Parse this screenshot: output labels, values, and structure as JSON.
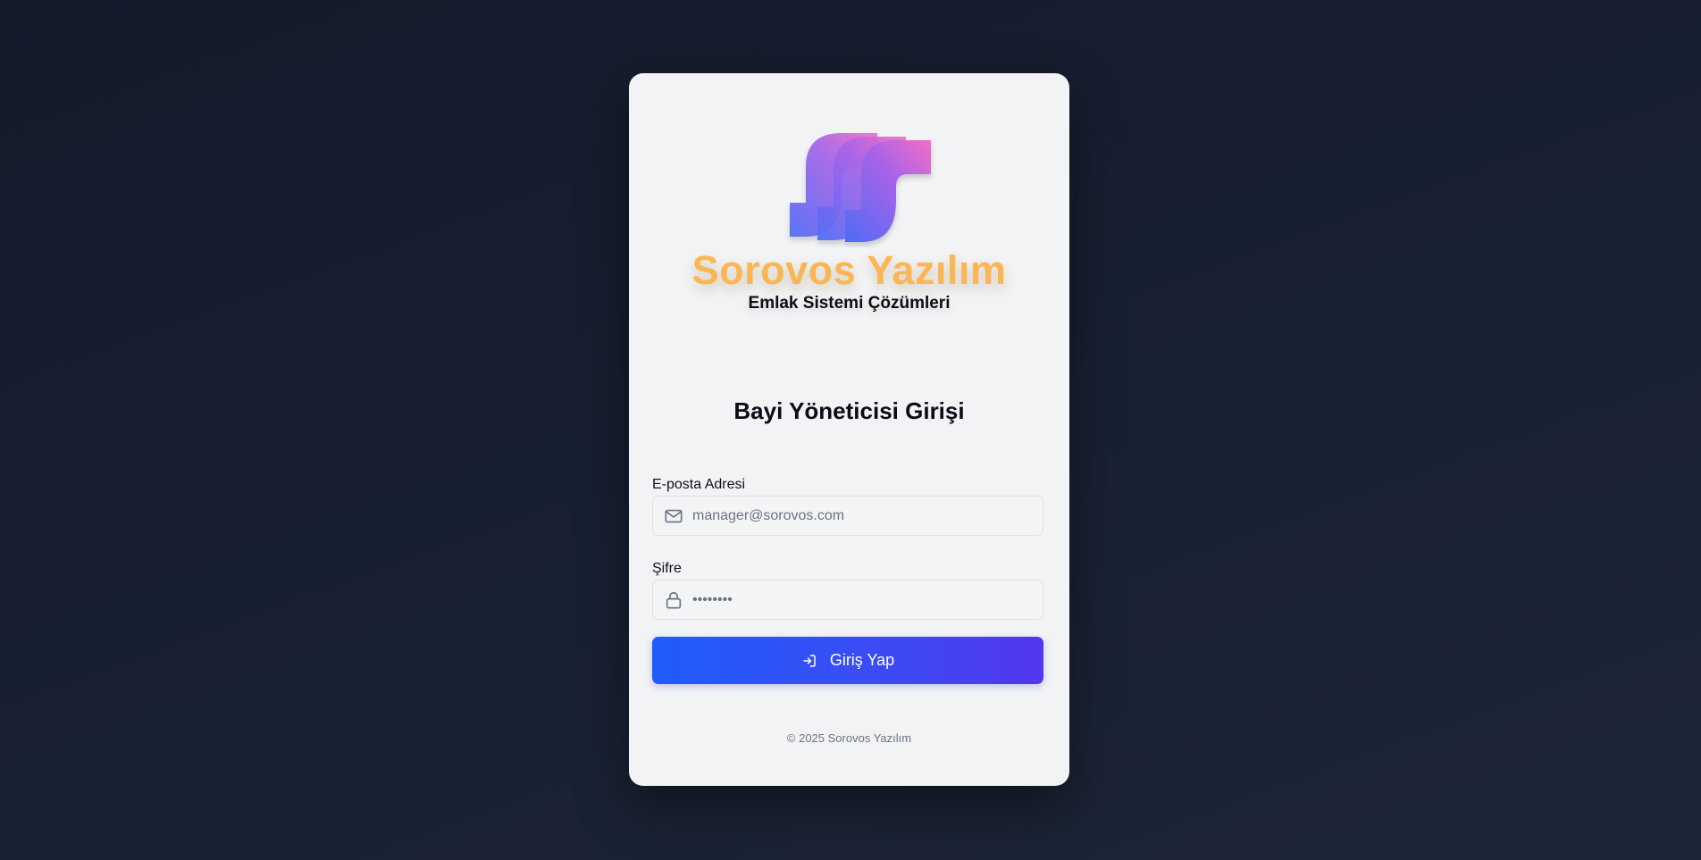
{
  "brand": {
    "name": "Sorovos Yazılım",
    "tagline": "Emlak Sistemi Çözümleri",
    "logo_icon": "sorovos-s-logo-icon",
    "colors": {
      "name": "#fbb654",
      "logo_gradient_start": "#4f6cf7",
      "logo_gradient_end": "#f26ec8"
    }
  },
  "form": {
    "title": "Bayi Yöneticisi Girişi",
    "email": {
      "label": "E-posta Adresi",
      "placeholder": "manager@sorovos.com",
      "value": "",
      "icon": "mail-icon"
    },
    "password": {
      "label": "Şifre",
      "value": "••••••••",
      "icon": "lock-icon"
    },
    "submit": {
      "label": "Giriş Yap",
      "icon": "login-arrow-icon",
      "colors": {
        "start": "#1f5cfb",
        "end": "#5137ee"
      }
    }
  },
  "footer": {
    "copyright": "© 2025 Sorovos Yazılım"
  }
}
